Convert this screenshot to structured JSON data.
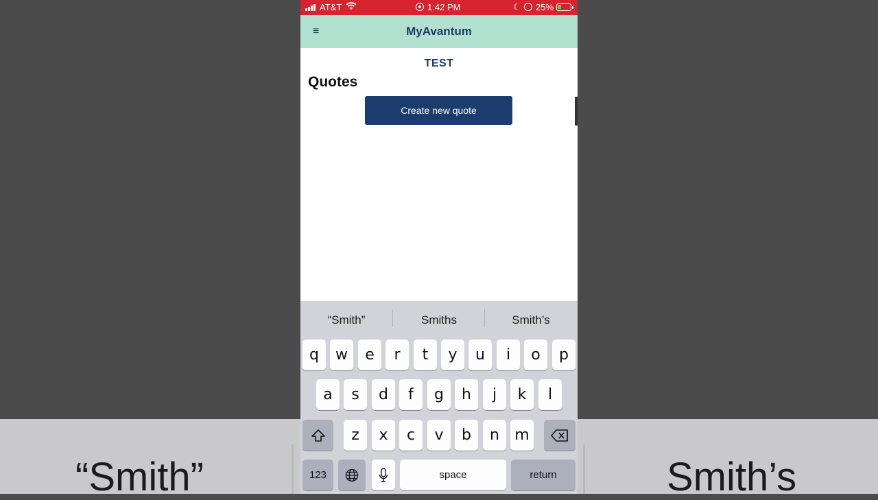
{
  "background": {
    "left_word": "“Smith”",
    "right_word": "Smith’s"
  },
  "status_bar": {
    "carrier": "AT&T",
    "time": "1:42 PM",
    "battery": "25%"
  },
  "header": {
    "title": "MyAvantum",
    "menu_icon": "≡"
  },
  "page": {
    "org_name": "TEST",
    "section_title": "Quotes",
    "create_button": "Create new quote"
  },
  "keyboard": {
    "predictions": [
      "“Smith”",
      "Smiths",
      "Smith’s"
    ],
    "row1": [
      "q",
      "w",
      "e",
      "r",
      "t",
      "y",
      "u",
      "i",
      "o",
      "p"
    ],
    "row2": [
      "a",
      "s",
      "d",
      "f",
      "g",
      "h",
      "j",
      "k",
      "l"
    ],
    "row3": [
      "z",
      "x",
      "c",
      "v",
      "b",
      "n",
      "m"
    ],
    "numbers_label": "123",
    "space_label": "space",
    "return_label": "return"
  },
  "colors": {
    "status_bar": "#d5232f",
    "header_bg": "#b2e1d0",
    "brand_navy": "#1b3c6d"
  }
}
